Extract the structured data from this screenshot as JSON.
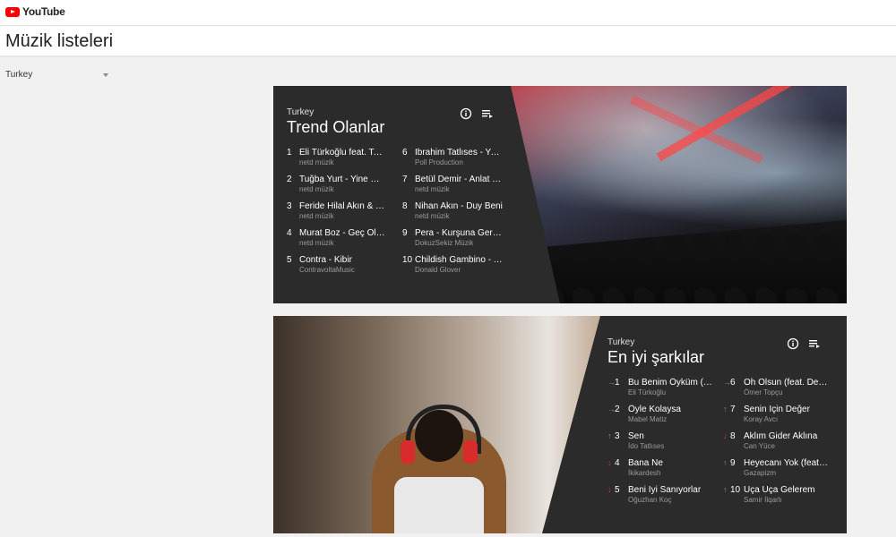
{
  "brand": {
    "logo_text": "YouTube"
  },
  "page": {
    "title": "Müzik listeleri"
  },
  "country_select": {
    "value": "Turkey"
  },
  "colors": {
    "brand_red": "#ff0000",
    "card_bg": "#2b2b2b",
    "trend_up": "#5a9aa4",
    "trend_down": "#d23a3a"
  },
  "icons": {
    "info": "info-icon",
    "playlist": "playlist-add-icon"
  },
  "trending": {
    "country": "Turkey",
    "title": "Trend Olanlar",
    "items": [
      {
        "rank": "1",
        "song": "Eli Türkoğlu feat. Taladro - Bu Benim Öyküm",
        "artist": "netd müzik"
      },
      {
        "rank": "2",
        "song": "Tuğba Yurt - Yine Sensiz",
        "artist": "netd müzik"
      },
      {
        "rank": "3",
        "song": "Feride Hilal Akın & İlyas Yalçıntaş",
        "artist": "netd müzik"
      },
      {
        "rank": "4",
        "song": "Murat Boz - Geç Olmadan",
        "artist": "netd müzik"
      },
      {
        "rank": "5",
        "song": "Contra - Kibir",
        "artist": "ContravoltaMusic"
      },
      {
        "rank": "6",
        "song": "İbrahim Tatlıses - Yaramızda",
        "artist": "Poll Production"
      },
      {
        "rank": "7",
        "song": "Betül Demir - Anlat Bana",
        "artist": "netd müzik"
      },
      {
        "rank": "8",
        "song": "Nihan Akın - Duy Beni",
        "artist": "netd müzik"
      },
      {
        "rank": "9",
        "song": "Pera - Kurşuna Gerek Yok",
        "artist": "DokuzSekiz Müzik"
      },
      {
        "rank": "10",
        "song": "Childish Gambino - This Is America",
        "artist": "Donald Glover"
      }
    ]
  },
  "top_songs": {
    "country": "Turkey",
    "title": "En iyi şarkılar",
    "items": [
      {
        "rank": "1",
        "trend": "same",
        "trend_symbol": "→",
        "song": "Bu Benim Öyküm (feat. Taladro)",
        "artist": "Eli Türkoğlu"
      },
      {
        "rank": "2",
        "trend": "same",
        "trend_symbol": "→",
        "song": "Öyle Kolaysa",
        "artist": "Mabel Matiz"
      },
      {
        "rank": "3",
        "trend": "up",
        "trend_symbol": "↑",
        "song": "Sen",
        "artist": "İdo Tatlıses"
      },
      {
        "rank": "4",
        "trend": "down",
        "trend_symbol": "↓",
        "song": "Bana Ne",
        "artist": "İkikardesh"
      },
      {
        "rank": "5",
        "trend": "down",
        "trend_symbol": "↓",
        "song": "Beni İyi Sanıyorlar",
        "artist": "Oğuzhan Koç"
      },
      {
        "rank": "6",
        "trend": "same",
        "trend_symbol": "→",
        "song": "Oh Olsun (feat. Derya Uluğ)",
        "artist": "Ömer Topçu"
      },
      {
        "rank": "7",
        "trend": "up",
        "trend_symbol": "↑",
        "song": "Senin İçin Değer",
        "artist": "Koray Avcı"
      },
      {
        "rank": "8",
        "trend": "down",
        "trend_symbol": "↓",
        "song": "Aklım Gider Aklına",
        "artist": "Can Yüce"
      },
      {
        "rank": "9",
        "trend": "up",
        "trend_symbol": "↑",
        "song": "Heyecanı Yok (feat. Gazapizm)",
        "artist": "Gazapizm"
      },
      {
        "rank": "10",
        "trend": "up",
        "trend_symbol": "↑",
        "song": "Uça Uça Gelerem",
        "artist": "Samir İlqarlı"
      }
    ]
  }
}
